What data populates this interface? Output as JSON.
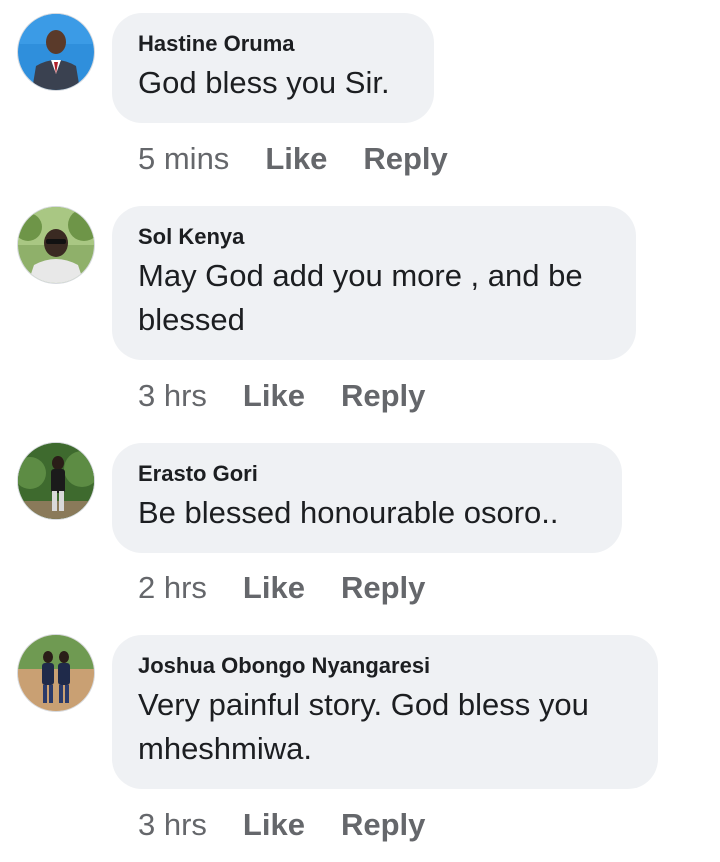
{
  "comments": [
    {
      "author": "Hastine Oruma",
      "text": "God bless you Sir.",
      "time": "5 mins",
      "like_label": "Like",
      "reply_label": "Reply",
      "avatar_bg": "#2f8fdc"
    },
    {
      "author": "Sol Kenya",
      "text": "May God add you more , and be blessed",
      "time": "3 hrs",
      "like_label": "Like",
      "reply_label": "Reply",
      "avatar_bg": "#7aa05a"
    },
    {
      "author": "Erasto Gori",
      "text": "Be blessed honourable osoro..",
      "time": "2 hrs",
      "like_label": "Like",
      "reply_label": "Reply",
      "avatar_bg": "#4f7a3a"
    },
    {
      "author": "Joshua Obongo Nyangaresi",
      "text": "Very painful story. God bless you mheshmiwa.",
      "time": "3 hrs",
      "like_label": "Like",
      "reply_label": "Reply",
      "avatar_bg": "#c9a073"
    }
  ],
  "colors": {
    "bubble": "#eff1f4",
    "author_text": "#1c1e21",
    "meta_text": "#65676b"
  }
}
